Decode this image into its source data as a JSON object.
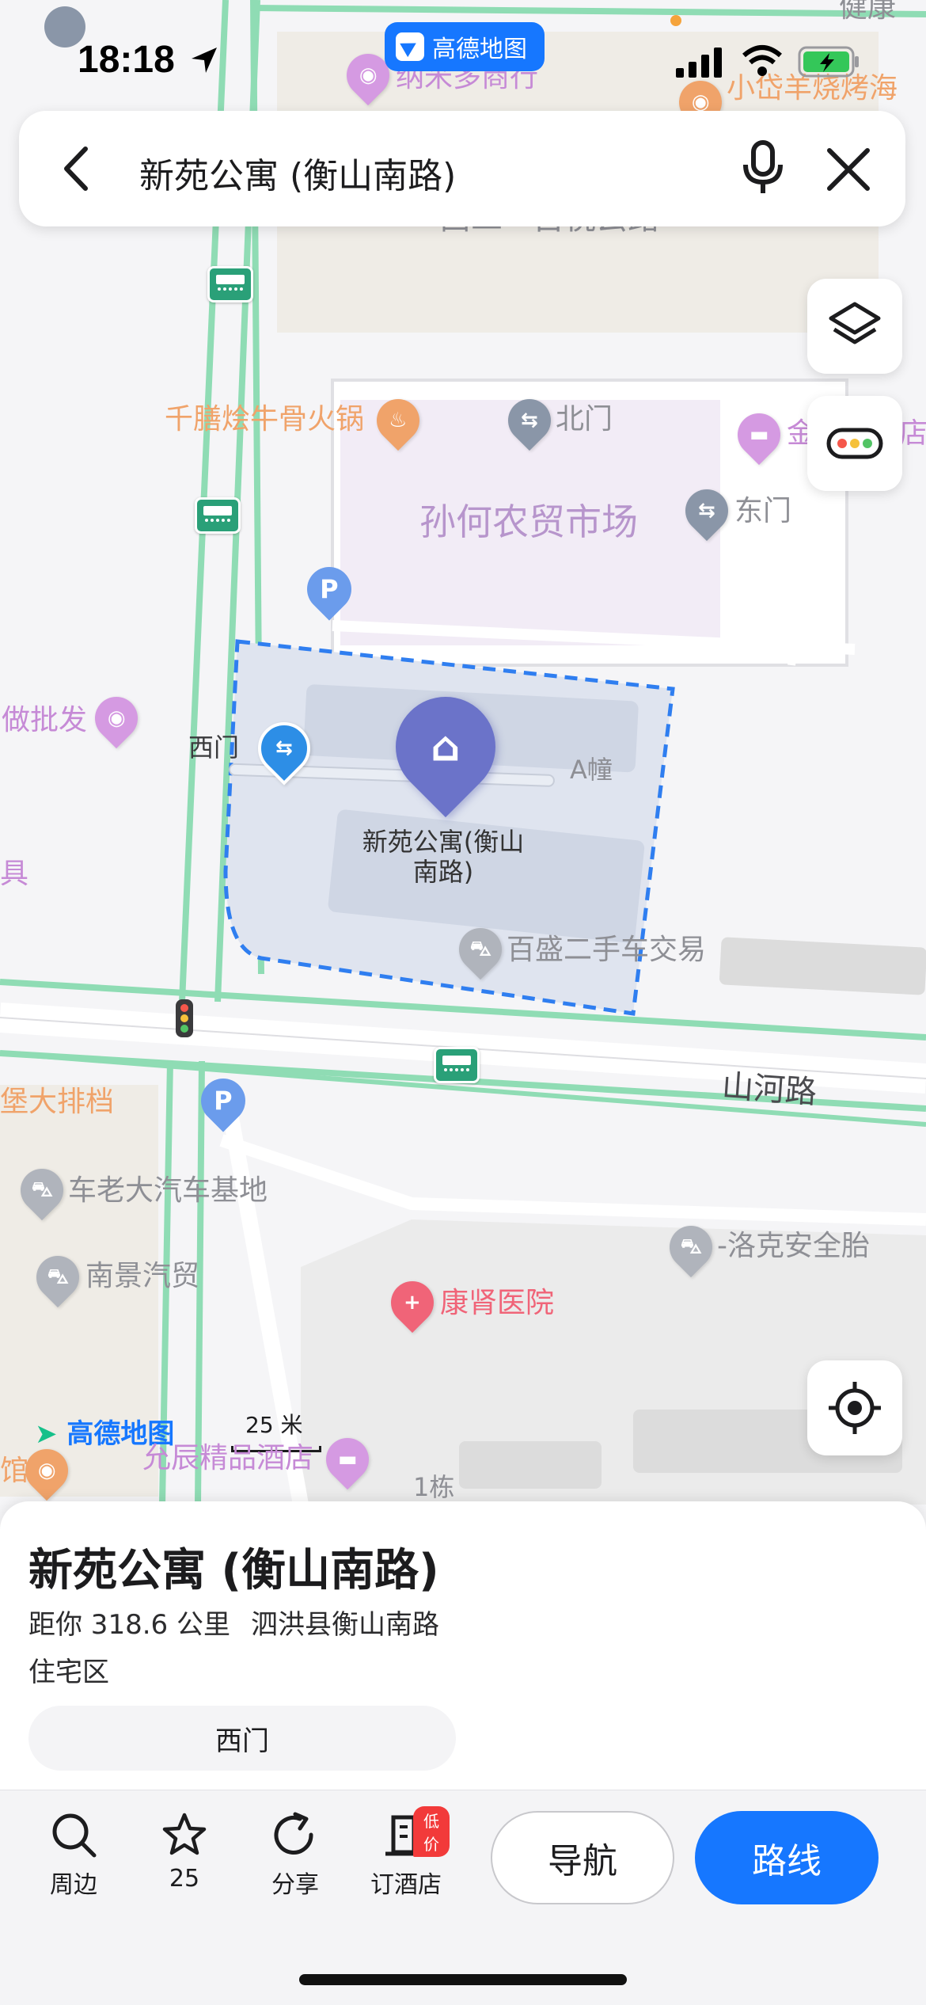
{
  "status_bar": {
    "time": "18:18",
    "app_badge": "高德地图"
  },
  "search": {
    "title": "新苑公寓 (衡山南路)",
    "back_icon": "back-arrow-icon",
    "mic_icon": "microphone-icon",
    "close_icon": "close-icon"
  },
  "map": {
    "pois": {
      "top_right_cut": "健康",
      "top_left": "纳米多商行",
      "top_right": "小岱羊烧烤海",
      "top_road": "西二 · 古悦云路",
      "hotpot": "千膳烩牛骨火锅",
      "north_gate": "北门",
      "hotel_cut": "金",
      "hotel_cut_right": "店",
      "market": "孙何农贸市场",
      "east_gate": "东门",
      "wholesale": "做批发",
      "west_gate": "西门",
      "building_a": "A幢",
      "selected_name_line1": "新苑公寓(衡山",
      "selected_name_line2": "南路)",
      "used_car": "百盛二手车交易",
      "left_cut": "具",
      "road_shanhe": "山河路",
      "food_stall": "堡大排档",
      "car_base": "车老大汽车基地",
      "nanjing_car": "南景汽贸",
      "tire": "-洛克安全胎",
      "hospital": "康肾医院",
      "hotel_bottom": "允辰精品酒店",
      "building_1": "1栋",
      "left_cut_bottom": "馆",
      "logo": "高德地图",
      "scale": "25 米"
    }
  },
  "fabs": {
    "layers_icon": "layers-icon",
    "traffic_icon": "traffic-light-icon",
    "locate_icon": "locate-icon"
  },
  "sheet": {
    "title": "新苑公寓 (衡山南路)",
    "distance": "距你 318.6 公里",
    "address": "泗洪县衡山南路",
    "type": "住宅区",
    "gate_chip": "西门"
  },
  "toolbar": {
    "nearby": "周边",
    "favorite": "25",
    "share": "分享",
    "hotel": "订酒店",
    "hotel_badge": "低价",
    "navigate": "导航",
    "route": "路线"
  },
  "colors": {
    "accent": "#1677ff",
    "road_green": "#8fdcb4",
    "area_fill": "#dfe4ef",
    "boundary": "#2f7ef0"
  }
}
